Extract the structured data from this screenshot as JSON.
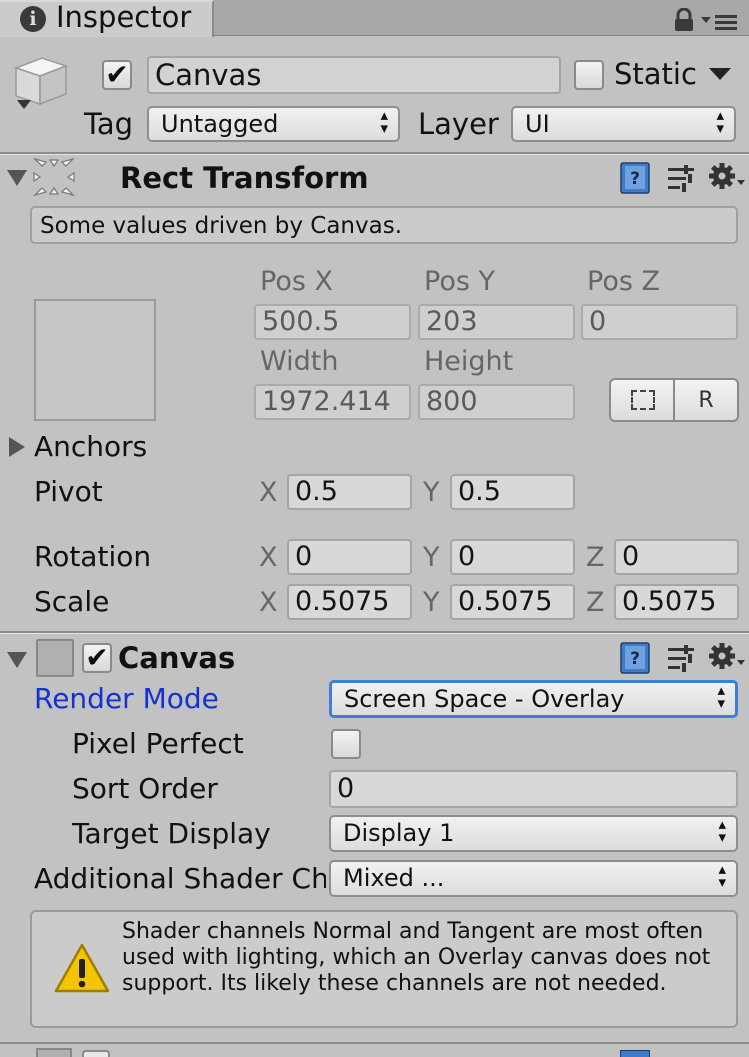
{
  "window": {
    "tab_title": "Inspector",
    "lock_icon": "lock-icon",
    "menu_icon": "tab-menu-icon"
  },
  "gameobject": {
    "active": true,
    "name": "Canvas",
    "static_label": "Static",
    "static_checked": false,
    "tag_label": "Tag",
    "tag_value": "Untagged",
    "layer_label": "Layer",
    "layer_value": "UI"
  },
  "rect_transform": {
    "title": "Rect Transform",
    "info": "Some values driven by Canvas.",
    "pos_x_label": "Pos X",
    "pos_y_label": "Pos Y",
    "pos_z_label": "Pos Z",
    "pos_x": "500.5",
    "pos_y": "203",
    "pos_z": "0",
    "width_label": "Width",
    "height_label": "Height",
    "width": "1972.414",
    "height": "800",
    "raw_button": "R",
    "anchors_label": "Anchors",
    "pivot_label": "Pivot",
    "pivot_x": "0.5",
    "pivot_y": "0.5",
    "rotation_label": "Rotation",
    "rotation_x": "0",
    "rotation_y": "0",
    "rotation_z": "0",
    "scale_label": "Scale",
    "scale_x": "0.5075",
    "scale_y": "0.5075",
    "scale_z": "0.5075",
    "axis_x": "X",
    "axis_y": "Y",
    "axis_z": "Z"
  },
  "canvas": {
    "title": "Canvas",
    "enabled": true,
    "render_mode_label": "Render Mode",
    "render_mode_value": "Screen Space - Overlay",
    "pixel_perfect_label": "Pixel Perfect",
    "pixel_perfect_checked": false,
    "sort_order_label": "Sort Order",
    "sort_order_value": "0",
    "target_display_label": "Target Display",
    "target_display_value": "Display 1",
    "shader_channels_label": "Additional Shader Ch",
    "shader_channels_value": "Mixed ...",
    "warning_text": "Shader channels Normal and Tangent are most often used with lighting, which an Overlay canvas does not support. Its likely these channels are not needed."
  },
  "colors": {
    "panel_bg": "#c2c2c2",
    "tab_bg": "#cbcbcb",
    "render_mode_blue": "#1432d2",
    "focus_border": "#3d7ddc",
    "warning_yellow": "#f5c400"
  }
}
